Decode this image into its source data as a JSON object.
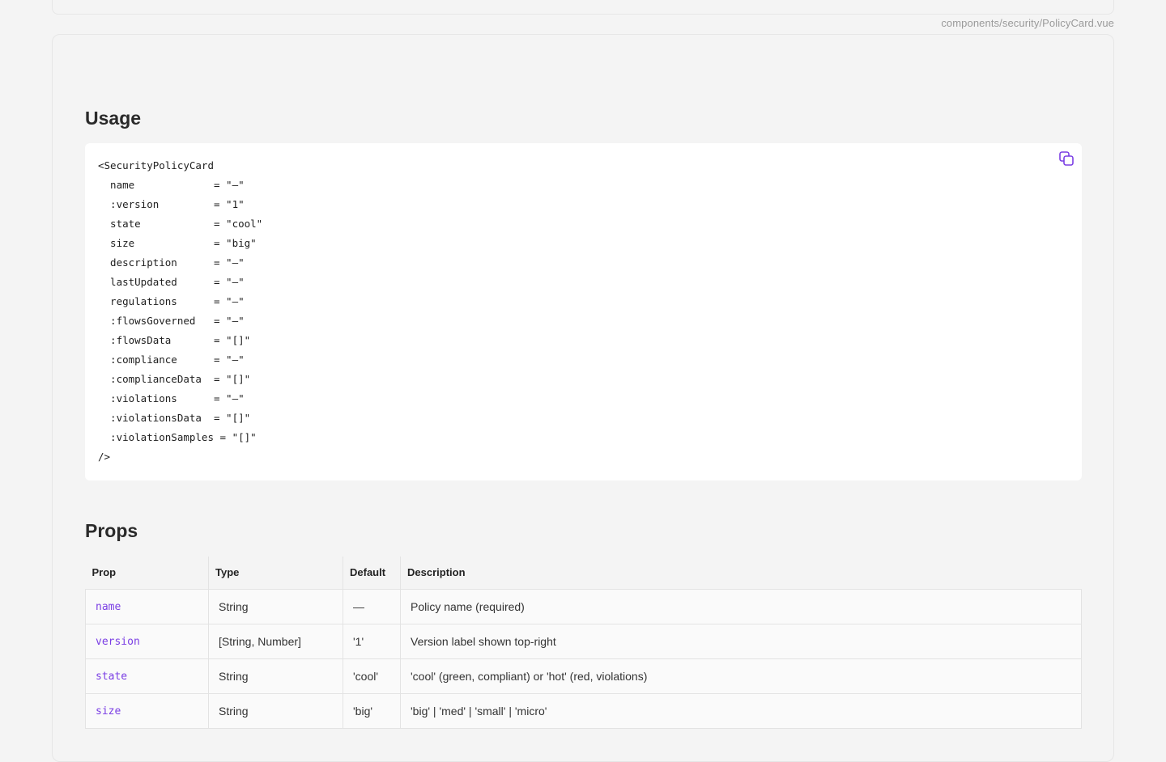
{
  "header": {
    "file_path": "components/security/PolicyCard.vue"
  },
  "usage": {
    "title": "Usage",
    "code_lines": [
      "<SecurityPolicyCard",
      "  name             = \"—\"",
      "  :version         = \"1\"",
      "  state            = \"cool\"",
      "  size             = \"big\"",
      "  description      = \"—\"",
      "  lastUpdated      = \"—\"",
      "  regulations      = \"—\"",
      "  :flowsGoverned   = \"—\"",
      "  :flowsData       = \"[]\"",
      "  :compliance      = \"—\"",
      "  :complianceData  = \"[]\"",
      "  :violations      = \"—\"",
      "  :violationsData  = \"[]\"",
      "  :violationSamples = \"[]\"",
      "/>"
    ],
    "copy_icon": "copy-icon",
    "accent": "#7b3fe4"
  },
  "props": {
    "title": "Props",
    "headers": [
      "Prop",
      "Type",
      "Default",
      "Description"
    ],
    "rows": [
      {
        "prop": "name",
        "type": "String",
        "default": "—",
        "description": "Policy name (required)"
      },
      {
        "prop": "version",
        "type": "[String, Number]",
        "default": "'1'",
        "description": "Version label shown top-right"
      },
      {
        "prop": "state",
        "type": "String",
        "default": "'cool'",
        "description": "'cool' (green, compliant) or 'hot' (red, violations)"
      },
      {
        "prop": "size",
        "type": "String",
        "default": "'big'",
        "description": "'big' | 'med' | 'small' | 'micro'"
      }
    ]
  }
}
